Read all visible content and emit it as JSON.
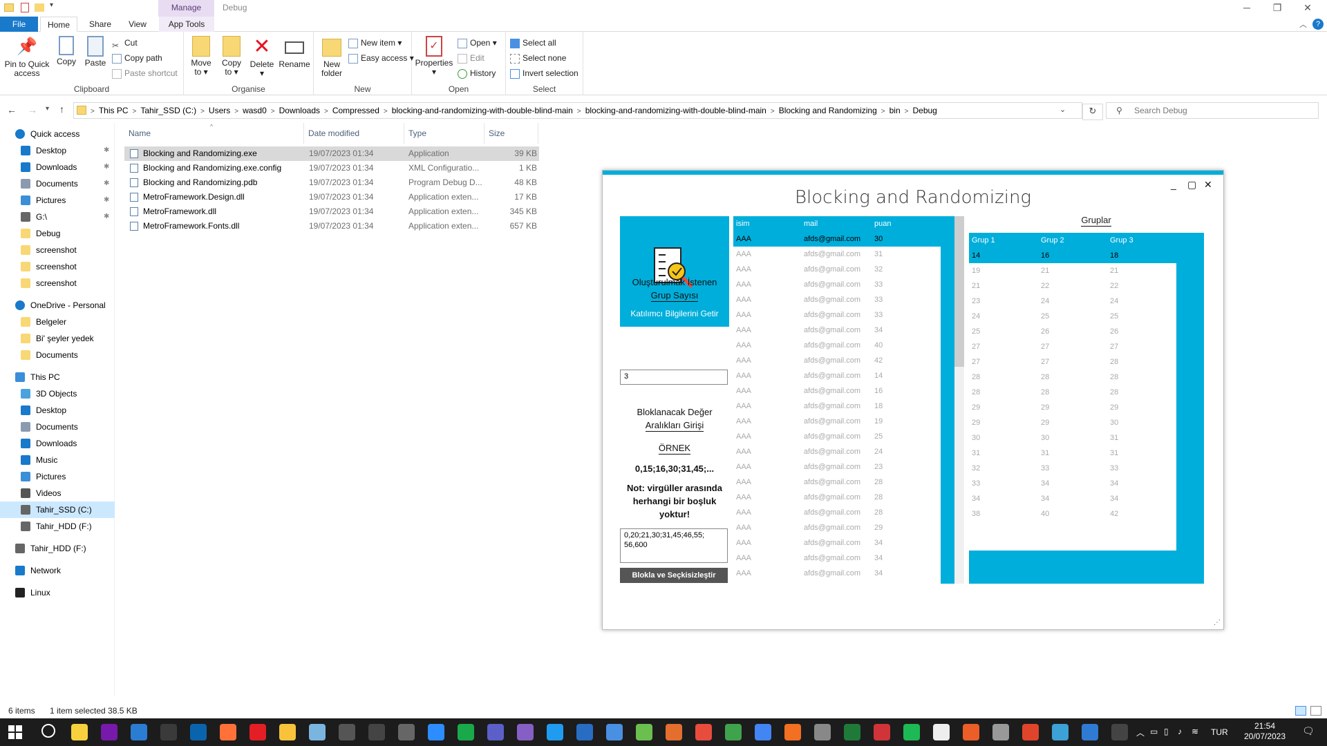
{
  "titlebar": {
    "ctx_manage": "Manage",
    "ctx_debug": "Debug",
    "minimize": "─",
    "restore": "❐",
    "close": "✕"
  },
  "ribbon_tabs": [
    "File",
    "Home",
    "Share",
    "View",
    "App Tools"
  ],
  "ribbon": {
    "clipboard": {
      "label": "Clipboard",
      "pin": [
        "Pin to Quick",
        "access"
      ],
      "copy": "Copy",
      "paste": "Paste",
      "cut": "Cut",
      "copy_path": "Copy path",
      "paste_shortcut": "Paste shortcut"
    },
    "organise": {
      "label": "Organise",
      "move_to": [
        "Move",
        "to ▾"
      ],
      "copy_to": [
        "Copy",
        "to ▾"
      ],
      "delete": [
        "Delete",
        "▾"
      ],
      "rename": "Rename"
    },
    "new": {
      "label": "New",
      "new_folder": [
        "New",
        "folder"
      ],
      "new_item": "New item ▾",
      "easy_access": "Easy access ▾"
    },
    "open": {
      "label": "Open",
      "properties": [
        "Properties",
        "▾"
      ],
      "open": "Open ▾",
      "edit": "Edit",
      "history": "History"
    },
    "select": {
      "label": "Select",
      "select_all": "Select all",
      "select_none": "Select none",
      "invert": "Invert selection"
    }
  },
  "address": {
    "crumbs": [
      "This PC",
      "Tahir_SSD (C:)",
      "Users",
      "wasd0",
      "Downloads",
      "Compressed",
      "blocking-and-randomizing-with-double-blind-main",
      "blocking-and-randomizing-with-double-blind-main",
      "Blocking and Randomizing",
      "bin",
      "Debug"
    ],
    "search_placeholder": "Search Debug"
  },
  "nav": {
    "items": [
      {
        "label": "Quick access",
        "icon": "star-icon",
        "color": "#1979ca",
        "indent": 0,
        "pin": false
      },
      {
        "label": "Desktop",
        "icon": "desktop-icon",
        "color": "#1979ca",
        "indent": 1,
        "pin": true
      },
      {
        "label": "Downloads",
        "icon": "download-icon",
        "color": "#1979ca",
        "indent": 1,
        "pin": true
      },
      {
        "label": "Documents",
        "icon": "documents-icon",
        "color": "#8a9bb0",
        "indent": 1,
        "pin": true
      },
      {
        "label": "Pictures",
        "icon": "pictures-icon",
        "color": "#3b8ed8",
        "indent": 1,
        "pin": true
      },
      {
        "label": "G:\\",
        "icon": "drive-icon",
        "color": "#666",
        "indent": 1,
        "pin": true
      },
      {
        "label": "Debug",
        "icon": "folder-icon",
        "color": "#f8d775",
        "indent": 1,
        "pin": false
      },
      {
        "label": "screenshot",
        "icon": "folder-icon",
        "color": "#f8d775",
        "indent": 1,
        "pin": false
      },
      {
        "label": "screenshot",
        "icon": "folder-icon",
        "color": "#f8d775",
        "indent": 1,
        "pin": false
      },
      {
        "label": "screenshot",
        "icon": "folder-icon",
        "color": "#f8d775",
        "indent": 1,
        "pin": false
      },
      {
        "label": "OneDrive - Personal",
        "icon": "cloud-icon",
        "color": "#1979ca",
        "indent": 0,
        "pin": false,
        "gap": true
      },
      {
        "label": "Belgeler",
        "icon": "folder-icon",
        "color": "#f8d775",
        "indent": 1,
        "pin": false
      },
      {
        "label": "Bi' şeyler yedek",
        "icon": "folder-icon",
        "color": "#f8d775",
        "indent": 1,
        "pin": false
      },
      {
        "label": "Documents",
        "icon": "folder-icon",
        "color": "#f8d775",
        "indent": 1,
        "pin": false
      },
      {
        "label": "This PC",
        "icon": "computer-icon",
        "color": "#3b8ed8",
        "indent": 0,
        "pin": false,
        "gap": true
      },
      {
        "label": "3D Objects",
        "icon": "cube-icon",
        "color": "#4aa3df",
        "indent": 1,
        "pin": false
      },
      {
        "label": "Desktop",
        "icon": "desktop-icon",
        "color": "#1979ca",
        "indent": 1,
        "pin": false
      },
      {
        "label": "Documents",
        "icon": "documents-icon",
        "color": "#8a9bb0",
        "indent": 1,
        "pin": false
      },
      {
        "label": "Downloads",
        "icon": "download-icon",
        "color": "#1979ca",
        "indent": 1,
        "pin": false
      },
      {
        "label": "Music",
        "icon": "music-icon",
        "color": "#1979ca",
        "indent": 1,
        "pin": false
      },
      {
        "label": "Pictures",
        "icon": "pictures-icon",
        "color": "#3b8ed8",
        "indent": 1,
        "pin": false
      },
      {
        "label": "Videos",
        "icon": "video-icon",
        "color": "#555",
        "indent": 1,
        "pin": false
      },
      {
        "label": "Tahir_SSD (C:)",
        "icon": "drive-icon",
        "color": "#666",
        "indent": 1,
        "pin": false,
        "selected": true
      },
      {
        "label": "Tahir_HDD (F:)",
        "icon": "drive-icon",
        "color": "#666",
        "indent": 1,
        "pin": false
      },
      {
        "label": "Tahir_HDD (F:)",
        "icon": "drive-icon",
        "color": "#666",
        "indent": 0,
        "pin": false,
        "gap": true
      },
      {
        "label": "Network",
        "icon": "network-icon",
        "color": "#1979ca",
        "indent": 0,
        "pin": false,
        "gap": true
      },
      {
        "label": "Linux",
        "icon": "linux-icon",
        "color": "#222",
        "indent": 0,
        "pin": false,
        "gap": true
      }
    ]
  },
  "files": {
    "columns": [
      "Name",
      "Date modified",
      "Type",
      "Size"
    ],
    "rows": [
      {
        "name": "Blocking and Randomizing.exe",
        "date": "19/07/2023 01:34",
        "type": "Application",
        "size": "39 KB",
        "selected": true
      },
      {
        "name": "Blocking and Randomizing.exe.config",
        "date": "19/07/2023 01:34",
        "type": "XML Configuratio...",
        "size": "1 KB"
      },
      {
        "name": "Blocking and Randomizing.pdb",
        "date": "19/07/2023 01:34",
        "type": "Program Debug D...",
        "size": "48 KB"
      },
      {
        "name": "MetroFramework.Design.dll",
        "date": "19/07/2023 01:34",
        "type": "Application exten...",
        "size": "17 KB"
      },
      {
        "name": "MetroFramework.dll",
        "date": "19/07/2023 01:34",
        "type": "Application exten...",
        "size": "345 KB"
      },
      {
        "name": "MetroFramework.Fonts.dll",
        "date": "19/07/2023 01:34",
        "type": "Application exten...",
        "size": "657 KB"
      }
    ]
  },
  "app": {
    "title": "Blocking and Randomizing",
    "accent": "#00aedb",
    "ctl_min": "_",
    "ctl_max": "▢",
    "ctl_close": "✕",
    "tile_label": "Katılımcı Bilgilerini Getir",
    "group_count_label_1": "Oluşturulmak İstenen",
    "group_count_label_2": "Grup Sayısı",
    "group_count_value": "3",
    "block_label_1": "Bloklanacak Değer",
    "block_label_2": "Aralıkları Girişi",
    "example_label": "ÖRNEK",
    "example_value": "0,15;16,30;31,45;...",
    "note": "Not: virgüller arasında herhangi bir boşluk yoktur!",
    "ranges_value": "0,20;21,30;31,45;46,55;\n56,600",
    "action_button": "Blokla ve Seçkisizleştir",
    "participants": {
      "columns": [
        "isim",
        "mail",
        "puan"
      ],
      "rows": [
        [
          "AAA",
          "afds@gmail.com",
          "30"
        ],
        [
          "AAA",
          "afds@gmail.com",
          "31"
        ],
        [
          "AAA",
          "afds@gmail.com",
          "32"
        ],
        [
          "AAA",
          "afds@gmail.com",
          "33"
        ],
        [
          "AAA",
          "afds@gmail.com",
          "33"
        ],
        [
          "AAA",
          "afds@gmail.com",
          "33"
        ],
        [
          "AAA",
          "afds@gmail.com",
          "34"
        ],
        [
          "AAA",
          "afds@gmail.com",
          "40"
        ],
        [
          "AAA",
          "afds@gmail.com",
          "42"
        ],
        [
          "AAA",
          "afds@gmail.com",
          "14"
        ],
        [
          "AAA",
          "afds@gmail.com",
          "16"
        ],
        [
          "AAA",
          "afds@gmail.com",
          "18"
        ],
        [
          "AAA",
          "afds@gmail.com",
          "19"
        ],
        [
          "AAA",
          "afds@gmail.com",
          "25"
        ],
        [
          "AAA",
          "afds@gmail.com",
          "24"
        ],
        [
          "AAA",
          "afds@gmail.com",
          "23"
        ],
        [
          "AAA",
          "afds@gmail.com",
          "28"
        ],
        [
          "AAA",
          "afds@gmail.com",
          "28"
        ],
        [
          "AAA",
          "afds@gmail.com",
          "28"
        ],
        [
          "AAA",
          "afds@gmail.com",
          "29"
        ],
        [
          "AAA",
          "afds@gmail.com",
          "34"
        ],
        [
          "AAA",
          "afds@gmail.com",
          "34"
        ],
        [
          "AAA",
          "afds@gmail.com",
          "34"
        ]
      ]
    },
    "groups_title": "Gruplar",
    "groups": {
      "columns": [
        "Grup 1",
        "Grup 2",
        "Grup 3"
      ],
      "rows": [
        [
          "14",
          "16",
          "18"
        ],
        [
          "19",
          "21",
          "21"
        ],
        [
          "21",
          "22",
          "22"
        ],
        [
          "23",
          "24",
          "24"
        ],
        [
          "24",
          "25",
          "25"
        ],
        [
          "25",
          "26",
          "26"
        ],
        [
          "27",
          "27",
          "27"
        ],
        [
          "27",
          "27",
          "28"
        ],
        [
          "28",
          "28",
          "28"
        ],
        [
          "28",
          "28",
          "28"
        ],
        [
          "29",
          "29",
          "29"
        ],
        [
          "29",
          "29",
          "30"
        ],
        [
          "30",
          "30",
          "31"
        ],
        [
          "31",
          "31",
          "31"
        ],
        [
          "32",
          "33",
          "33"
        ],
        [
          "33",
          "34",
          "34"
        ],
        [
          "34",
          "34",
          "34"
        ],
        [
          "38",
          "40",
          "42"
        ]
      ]
    }
  },
  "status": {
    "items": "6 items",
    "selected": "1 item selected  38.5 KB"
  },
  "taskbar": {
    "apps": [
      {
        "name": "search-icon",
        "color": "#1c1c1c"
      },
      {
        "name": "sticky-notes-icon",
        "color": "#f7d13d"
      },
      {
        "name": "onenote-icon",
        "color": "#7719aa"
      },
      {
        "name": "display-icon",
        "color": "#2b7cd3"
      },
      {
        "name": "calculator-icon",
        "color": "#3a3a3a"
      },
      {
        "name": "mail-icon",
        "color": "#0a64ad"
      },
      {
        "name": "firefox-icon",
        "color": "#ff7139"
      },
      {
        "name": "acrobat-icon",
        "color": "#e41e25"
      },
      {
        "name": "file-explorer-icon",
        "color": "#f8c33b"
      },
      {
        "name": "app-icon",
        "color": "#7ab5e0"
      },
      {
        "name": "desktop-app-icon",
        "color": "#555"
      },
      {
        "name": "notion-icon",
        "color": "#444"
      },
      {
        "name": "notepad-icon",
        "color": "#666"
      },
      {
        "name": "zoom-icon",
        "color": "#2d8cff"
      },
      {
        "name": "camtasia-icon",
        "color": "#19a94b"
      },
      {
        "name": "teams-icon",
        "color": "#5b5fc7"
      },
      {
        "name": "visual-studio-icon",
        "color": "#865fc5"
      },
      {
        "name": "vscode-icon",
        "color": "#1f9cf0"
      },
      {
        "name": "r-icon",
        "color": "#276dc3"
      },
      {
        "name": "app-blue-icon",
        "color": "#4a90e2"
      },
      {
        "name": "app-green-icon",
        "color": "#6bbf4e"
      },
      {
        "name": "matlab-icon",
        "color": "#e46e2e"
      },
      {
        "name": "pdf-icon",
        "color": "#e84c3d"
      },
      {
        "name": "app-tools-icon",
        "color": "#3fa34d"
      },
      {
        "name": "chrome-icon",
        "color": "#4285f4"
      },
      {
        "name": "pen-icon",
        "color": "#f36f21"
      },
      {
        "name": "cad-icon",
        "color": "#888"
      },
      {
        "name": "shield-app-icon",
        "color": "#1f7a3a"
      },
      {
        "name": "app-flag-icon",
        "color": "#d13438"
      },
      {
        "name": "spotify-icon",
        "color": "#1db954"
      },
      {
        "name": "notion2-icon",
        "color": "#eee"
      },
      {
        "name": "office-icon",
        "color": "#eb5e28"
      },
      {
        "name": "app-stripes-icon",
        "color": "#999"
      },
      {
        "name": "davinci-icon",
        "color": "#e0452b"
      },
      {
        "name": "git-icon",
        "color": "#3ca1d6"
      },
      {
        "name": "photos-icon",
        "color": "#2f7bd3"
      },
      {
        "name": "psi-app-icon",
        "color": "#444"
      }
    ],
    "lang": "TUR",
    "time": "21:54",
    "date": "20/07/2023"
  }
}
